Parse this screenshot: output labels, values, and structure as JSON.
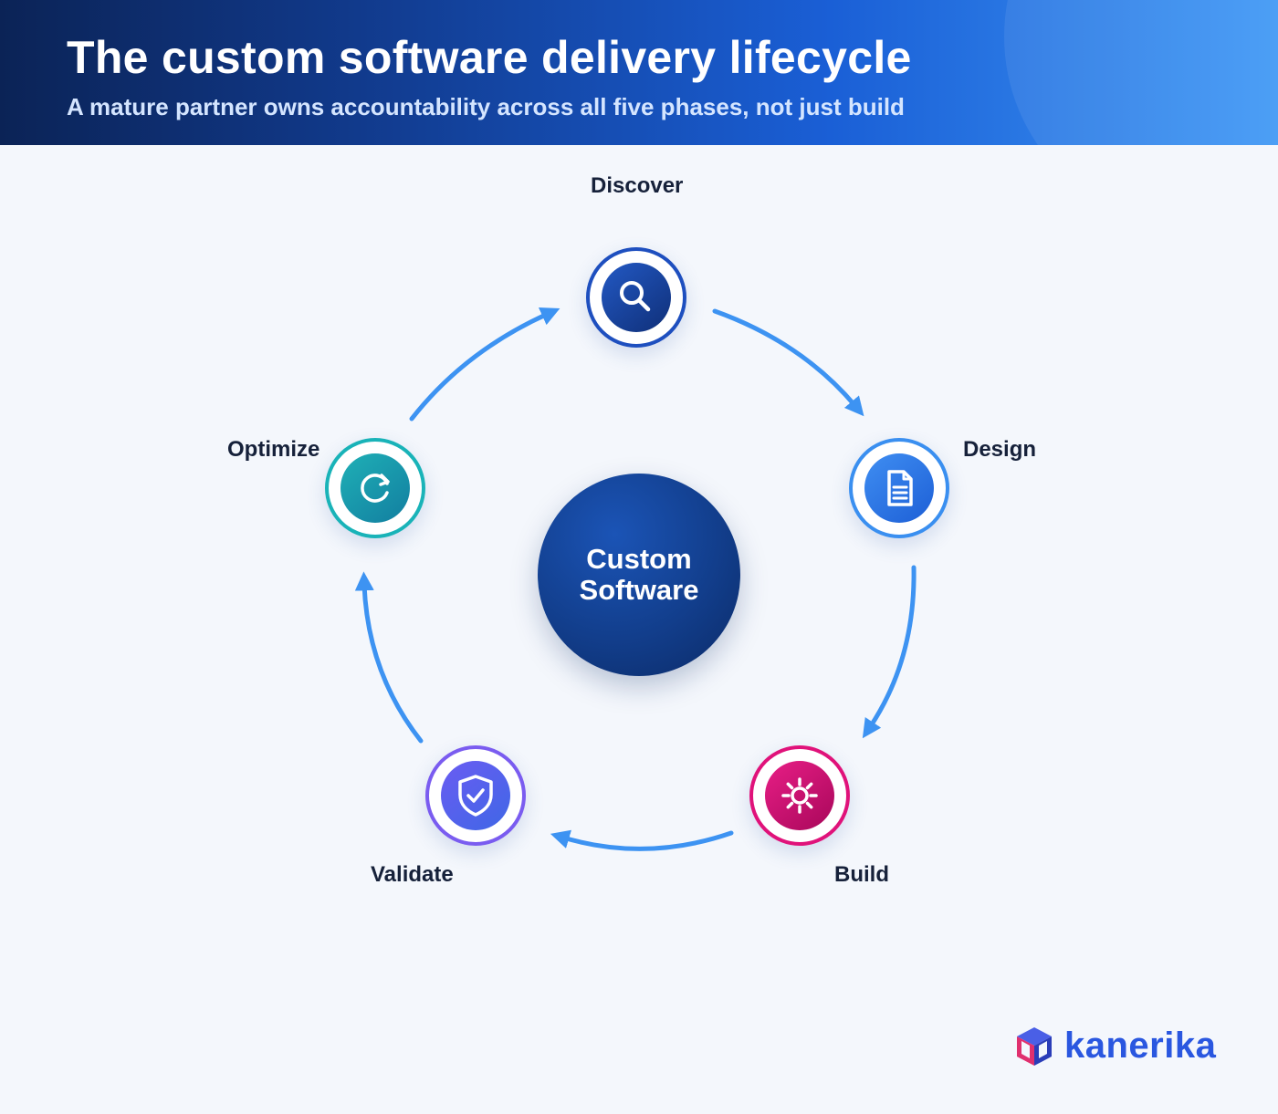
{
  "header": {
    "title": "The custom software delivery lifecycle",
    "subtitle": "A mature partner owns accountability across all five phases, not just build"
  },
  "center": {
    "label": "Custom Software",
    "color": "#123e8c"
  },
  "phases": [
    {
      "label": "Discover",
      "icon": "magnifier-icon",
      "color": "#1e4fbf"
    },
    {
      "label": "Design",
      "icon": "document-icon",
      "color": "#3a8ff0"
    },
    {
      "label": "Build",
      "icon": "gear-icon",
      "color": "#e0127a"
    },
    {
      "label": "Validate",
      "icon": "shield-check-icon",
      "color": "#7a5cf0"
    },
    {
      "label": "Optimize",
      "icon": "refresh-icon",
      "color": "#19b3b8"
    }
  ],
  "arrow_color": "#3d93f2",
  "logo": {
    "text": "kanerika",
    "color": "#2a57e0"
  }
}
